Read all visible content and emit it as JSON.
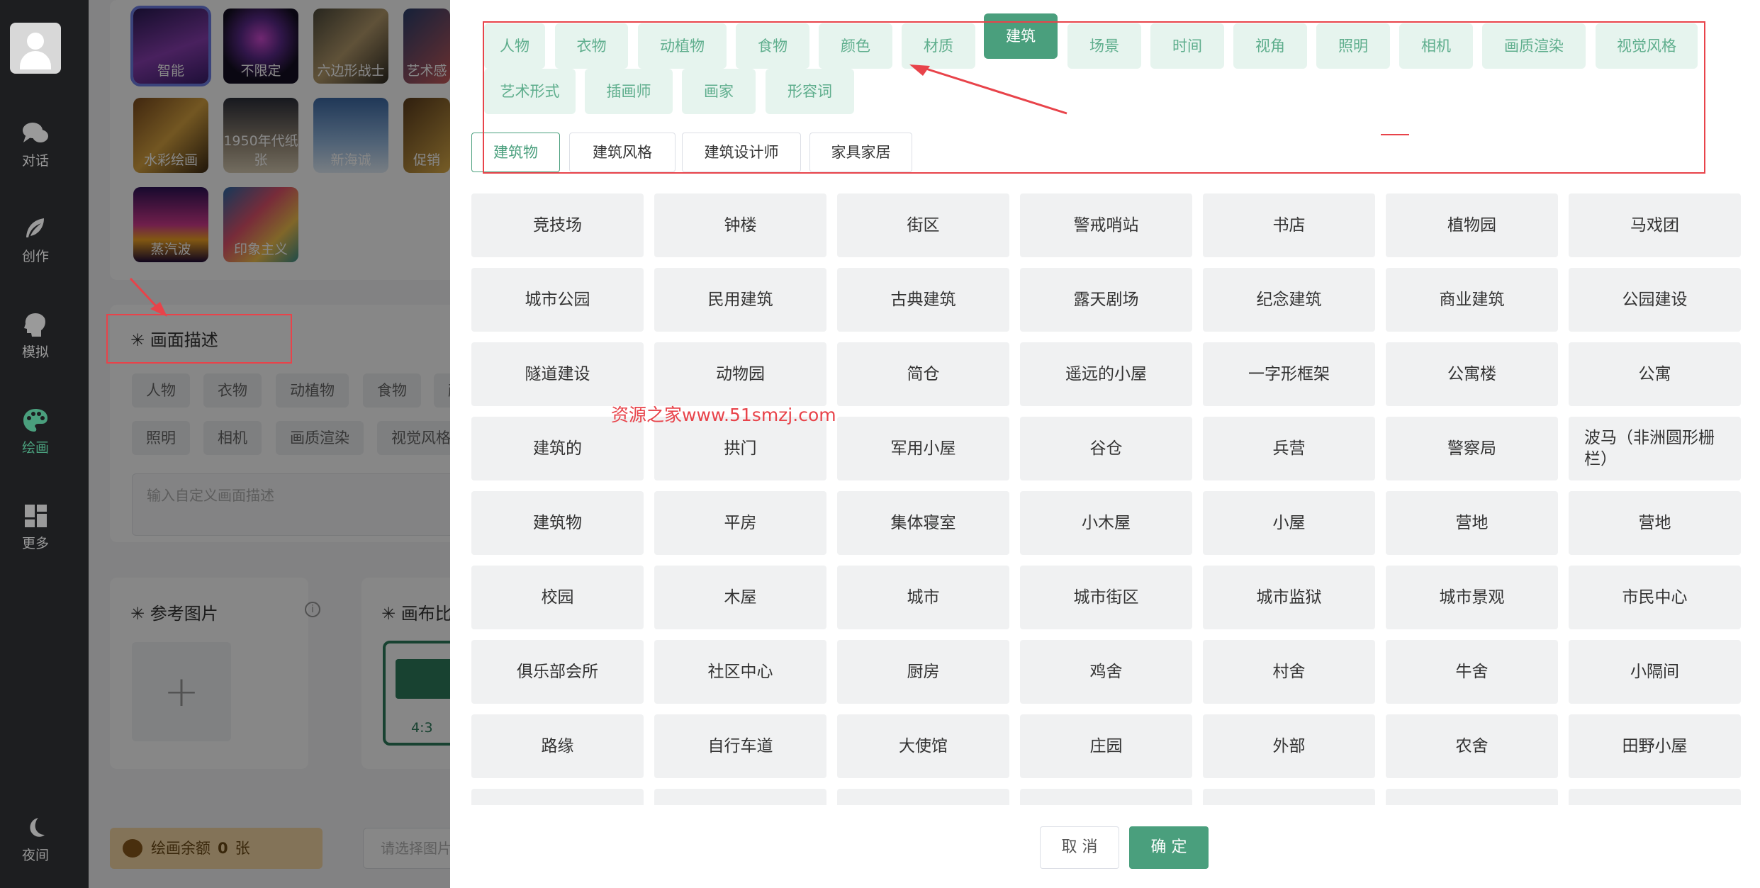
{
  "nav": {
    "items": [
      {
        "label": "对话",
        "icon": "chat-icon"
      },
      {
        "label": "创作",
        "icon": "feather-icon"
      },
      {
        "label": "模拟",
        "icon": "head-icon"
      },
      {
        "label": "绘画",
        "icon": "palette-icon",
        "active": true
      },
      {
        "label": "更多",
        "icon": "grid-icon"
      }
    ],
    "night_label": "夜间",
    "night_icon": "moon-icon"
  },
  "styles": [
    {
      "label": "智能",
      "selected": true
    },
    {
      "label": "不限定"
    },
    {
      "label": "六边形战士"
    },
    {
      "label": "艺术感"
    },
    {
      "label": "水彩绘画"
    },
    {
      "label": "1950年代纸张"
    },
    {
      "label": "新海诚"
    },
    {
      "label": "促销"
    },
    {
      "label": "蒸汽波"
    },
    {
      "label": "印象主义"
    }
  ],
  "description": {
    "title": "画面描述",
    "chips_row1": [
      "人物",
      "衣物",
      "动植物",
      "食物",
      "颜"
    ],
    "chips_row2": [
      "照明",
      "相机",
      "画质渲染",
      "视觉风格"
    ],
    "placeholder": "输入自定义画面描述"
  },
  "reference": {
    "title": "参考图片",
    "info_icon": "info-icon",
    "add_icon": "plus-icon"
  },
  "canvas": {
    "title": "画布比",
    "ratio": "4:3"
  },
  "balance": {
    "label": "绘画余额",
    "value": "0",
    "unit": "张"
  },
  "select_placeholder": "请选择图片",
  "drawer": {
    "tabs": [
      "人物",
      "衣物",
      "动植物",
      "食物",
      "颜色",
      "材质",
      "建筑",
      "场景",
      "时间",
      "视角",
      "照明",
      "相机",
      "画质渲染",
      "视觉风格",
      "艺术形式",
      "插画师",
      "画家",
      "形容词"
    ],
    "active_tab": "建筑",
    "subtabs": [
      "建筑物",
      "建筑风格",
      "建筑设计师",
      "家具家居"
    ],
    "active_subtab": "建筑物",
    "items": [
      "竞技场",
      "钟楼",
      "街区",
      "警戒哨站",
      "书店",
      "植物园",
      "马戏团",
      "城市公园",
      "民用建筑",
      "古典建筑",
      "露天剧场",
      "纪念建筑",
      "商业建筑",
      "公园建设",
      "隧道建设",
      "动物园",
      "简仓",
      "遥远的小屋",
      "一字形框架",
      "公寓楼",
      "公寓",
      "建筑的",
      "拱门",
      "军用小屋",
      "谷仓",
      "兵营",
      "警察局",
      "波马（非洲圆形栅栏）",
      "建筑物",
      "平房",
      "集体寝室",
      "小木屋",
      "小屋",
      "营地",
      "营地",
      "校园",
      "木屋",
      "城市",
      "城市街区",
      "城市监狱",
      "城市景观",
      "市民中心",
      "俱乐部会所",
      "社区中心",
      "厨房",
      "鸡舍",
      "村舍",
      "牛舍",
      "小隔间",
      "路缘",
      "自行车道",
      "大使馆",
      "庄园",
      "外部",
      "农舍",
      "田野小屋"
    ],
    "cancel_label": "取 消",
    "confirm_label": "确 定"
  },
  "watermark": "资源之家www.51smzj.com",
  "colors": {
    "accent": "#4a9f7d",
    "accent_light": "#e6f4ee",
    "annotation_red": "#e8434a",
    "nav_bg": "#1d1e20"
  }
}
